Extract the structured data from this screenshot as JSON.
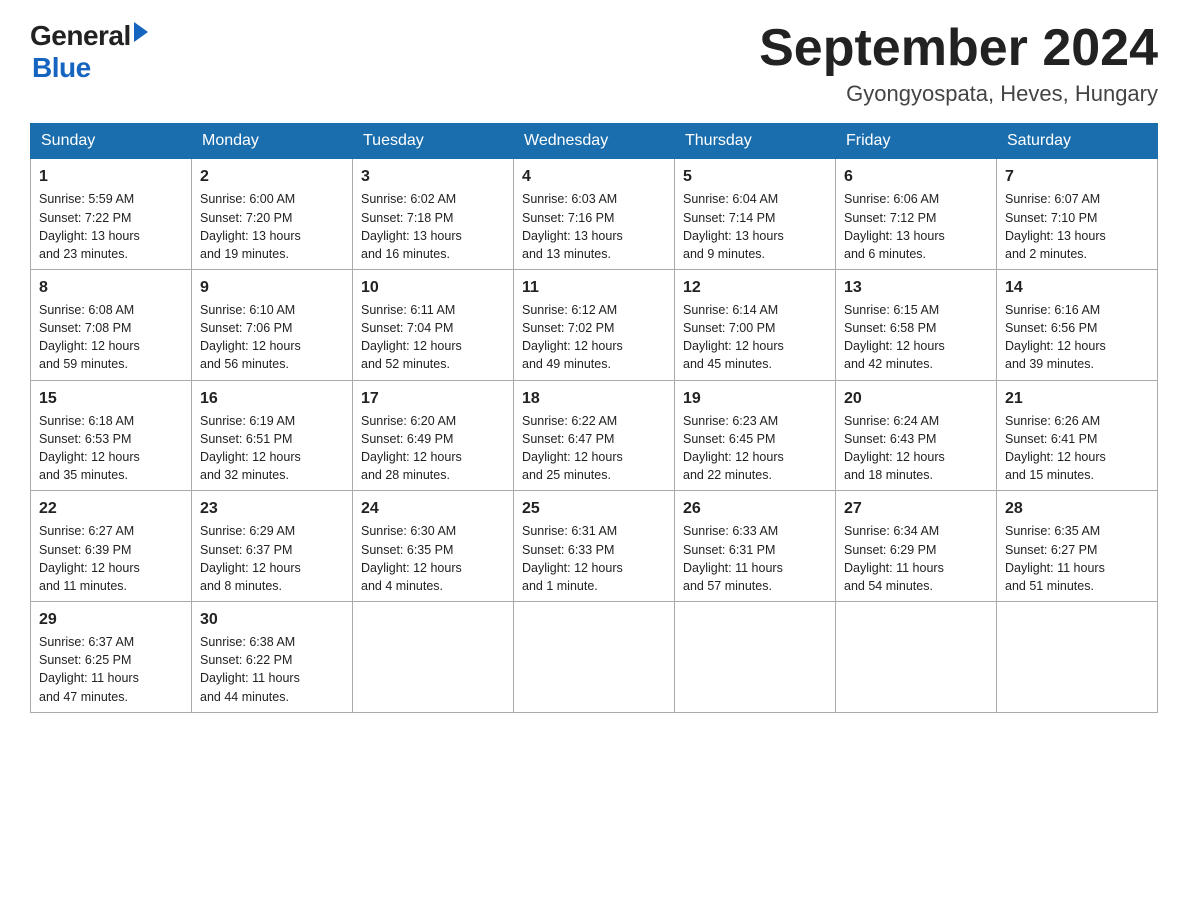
{
  "logo": {
    "general": "General",
    "blue": "Blue"
  },
  "title": "September 2024",
  "location": "Gyongyospata, Heves, Hungary",
  "days_of_week": [
    "Sunday",
    "Monday",
    "Tuesday",
    "Wednesday",
    "Thursday",
    "Friday",
    "Saturday"
  ],
  "weeks": [
    [
      {
        "day": "1",
        "info": "Sunrise: 5:59 AM\nSunset: 7:22 PM\nDaylight: 13 hours\nand 23 minutes."
      },
      {
        "day": "2",
        "info": "Sunrise: 6:00 AM\nSunset: 7:20 PM\nDaylight: 13 hours\nand 19 minutes."
      },
      {
        "day": "3",
        "info": "Sunrise: 6:02 AM\nSunset: 7:18 PM\nDaylight: 13 hours\nand 16 minutes."
      },
      {
        "day": "4",
        "info": "Sunrise: 6:03 AM\nSunset: 7:16 PM\nDaylight: 13 hours\nand 13 minutes."
      },
      {
        "day": "5",
        "info": "Sunrise: 6:04 AM\nSunset: 7:14 PM\nDaylight: 13 hours\nand 9 minutes."
      },
      {
        "day": "6",
        "info": "Sunrise: 6:06 AM\nSunset: 7:12 PM\nDaylight: 13 hours\nand 6 minutes."
      },
      {
        "day": "7",
        "info": "Sunrise: 6:07 AM\nSunset: 7:10 PM\nDaylight: 13 hours\nand 2 minutes."
      }
    ],
    [
      {
        "day": "8",
        "info": "Sunrise: 6:08 AM\nSunset: 7:08 PM\nDaylight: 12 hours\nand 59 minutes."
      },
      {
        "day": "9",
        "info": "Sunrise: 6:10 AM\nSunset: 7:06 PM\nDaylight: 12 hours\nand 56 minutes."
      },
      {
        "day": "10",
        "info": "Sunrise: 6:11 AM\nSunset: 7:04 PM\nDaylight: 12 hours\nand 52 minutes."
      },
      {
        "day": "11",
        "info": "Sunrise: 6:12 AM\nSunset: 7:02 PM\nDaylight: 12 hours\nand 49 minutes."
      },
      {
        "day": "12",
        "info": "Sunrise: 6:14 AM\nSunset: 7:00 PM\nDaylight: 12 hours\nand 45 minutes."
      },
      {
        "day": "13",
        "info": "Sunrise: 6:15 AM\nSunset: 6:58 PM\nDaylight: 12 hours\nand 42 minutes."
      },
      {
        "day": "14",
        "info": "Sunrise: 6:16 AM\nSunset: 6:56 PM\nDaylight: 12 hours\nand 39 minutes."
      }
    ],
    [
      {
        "day": "15",
        "info": "Sunrise: 6:18 AM\nSunset: 6:53 PM\nDaylight: 12 hours\nand 35 minutes."
      },
      {
        "day": "16",
        "info": "Sunrise: 6:19 AM\nSunset: 6:51 PM\nDaylight: 12 hours\nand 32 minutes."
      },
      {
        "day": "17",
        "info": "Sunrise: 6:20 AM\nSunset: 6:49 PM\nDaylight: 12 hours\nand 28 minutes."
      },
      {
        "day": "18",
        "info": "Sunrise: 6:22 AM\nSunset: 6:47 PM\nDaylight: 12 hours\nand 25 minutes."
      },
      {
        "day": "19",
        "info": "Sunrise: 6:23 AM\nSunset: 6:45 PM\nDaylight: 12 hours\nand 22 minutes."
      },
      {
        "day": "20",
        "info": "Sunrise: 6:24 AM\nSunset: 6:43 PM\nDaylight: 12 hours\nand 18 minutes."
      },
      {
        "day": "21",
        "info": "Sunrise: 6:26 AM\nSunset: 6:41 PM\nDaylight: 12 hours\nand 15 minutes."
      }
    ],
    [
      {
        "day": "22",
        "info": "Sunrise: 6:27 AM\nSunset: 6:39 PM\nDaylight: 12 hours\nand 11 minutes."
      },
      {
        "day": "23",
        "info": "Sunrise: 6:29 AM\nSunset: 6:37 PM\nDaylight: 12 hours\nand 8 minutes."
      },
      {
        "day": "24",
        "info": "Sunrise: 6:30 AM\nSunset: 6:35 PM\nDaylight: 12 hours\nand 4 minutes."
      },
      {
        "day": "25",
        "info": "Sunrise: 6:31 AM\nSunset: 6:33 PM\nDaylight: 12 hours\nand 1 minute."
      },
      {
        "day": "26",
        "info": "Sunrise: 6:33 AM\nSunset: 6:31 PM\nDaylight: 11 hours\nand 57 minutes."
      },
      {
        "day": "27",
        "info": "Sunrise: 6:34 AM\nSunset: 6:29 PM\nDaylight: 11 hours\nand 54 minutes."
      },
      {
        "day": "28",
        "info": "Sunrise: 6:35 AM\nSunset: 6:27 PM\nDaylight: 11 hours\nand 51 minutes."
      }
    ],
    [
      {
        "day": "29",
        "info": "Sunrise: 6:37 AM\nSunset: 6:25 PM\nDaylight: 11 hours\nand 47 minutes."
      },
      {
        "day": "30",
        "info": "Sunrise: 6:38 AM\nSunset: 6:22 PM\nDaylight: 11 hours\nand 44 minutes."
      },
      {
        "day": "",
        "info": ""
      },
      {
        "day": "",
        "info": ""
      },
      {
        "day": "",
        "info": ""
      },
      {
        "day": "",
        "info": ""
      },
      {
        "day": "",
        "info": ""
      }
    ]
  ]
}
